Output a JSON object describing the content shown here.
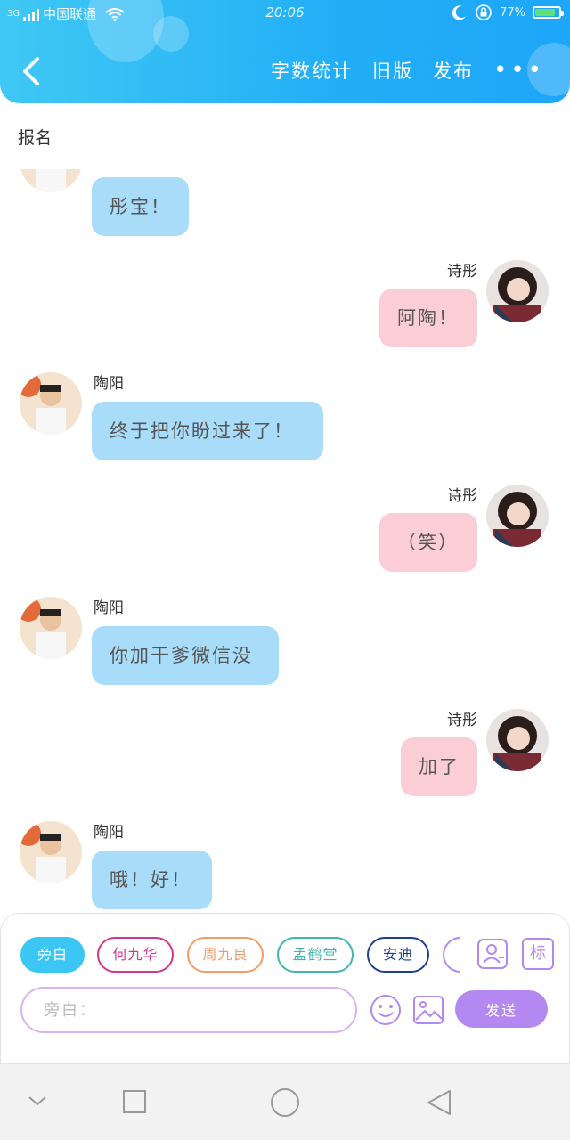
{
  "status_bar": {
    "network_type": "3G",
    "carrier": "中国联通",
    "time": "20:06",
    "battery": "77%",
    "battery_level": 0.77
  },
  "header": {
    "word_count": "字数统计",
    "old_version": "旧版",
    "publish": "发布",
    "more": "•••"
  },
  "topic": "报名",
  "chat": {
    "messages": [
      {
        "side": "left",
        "name": "",
        "text": "彤宝！"
      },
      {
        "side": "right",
        "name": "诗彤",
        "text": "阿陶！"
      },
      {
        "side": "left",
        "name": "陶阳",
        "text": "终于把你盼过来了！"
      },
      {
        "side": "right",
        "name": "诗彤",
        "text": "（笑）"
      },
      {
        "side": "left",
        "name": "陶阳",
        "text": "你加干爹微信没"
      },
      {
        "side": "right",
        "name": "诗彤",
        "text": "加了"
      },
      {
        "side": "left",
        "name": "陶阳",
        "text": "哦！好！"
      }
    ]
  },
  "roles": [
    {
      "label": "旁白",
      "color": "#3cc6f3",
      "selected": true
    },
    {
      "label": "何九华",
      "color": "#d2358f",
      "selected": false
    },
    {
      "label": "周九良",
      "color": "#f39c6a",
      "selected": false
    },
    {
      "label": "孟鹤堂",
      "color": "#3fb5b0",
      "selected": false
    },
    {
      "label": "安迪",
      "color": "#1d3f8e",
      "selected": false
    },
    {
      "label": "",
      "color": "#b388f0",
      "selected": false
    }
  ],
  "input": {
    "placeholder": "旁白：",
    "send": "发送"
  },
  "icons": {
    "role_manage": "person-card-icon",
    "tag": "标",
    "emoji": "smiley-icon",
    "image": "image-icon"
  },
  "colors": {
    "header": "#22aef7",
    "left_bubble": "#a9dcf9",
    "right_bubble": "#fbcdd6",
    "accent": "#b388f0"
  }
}
